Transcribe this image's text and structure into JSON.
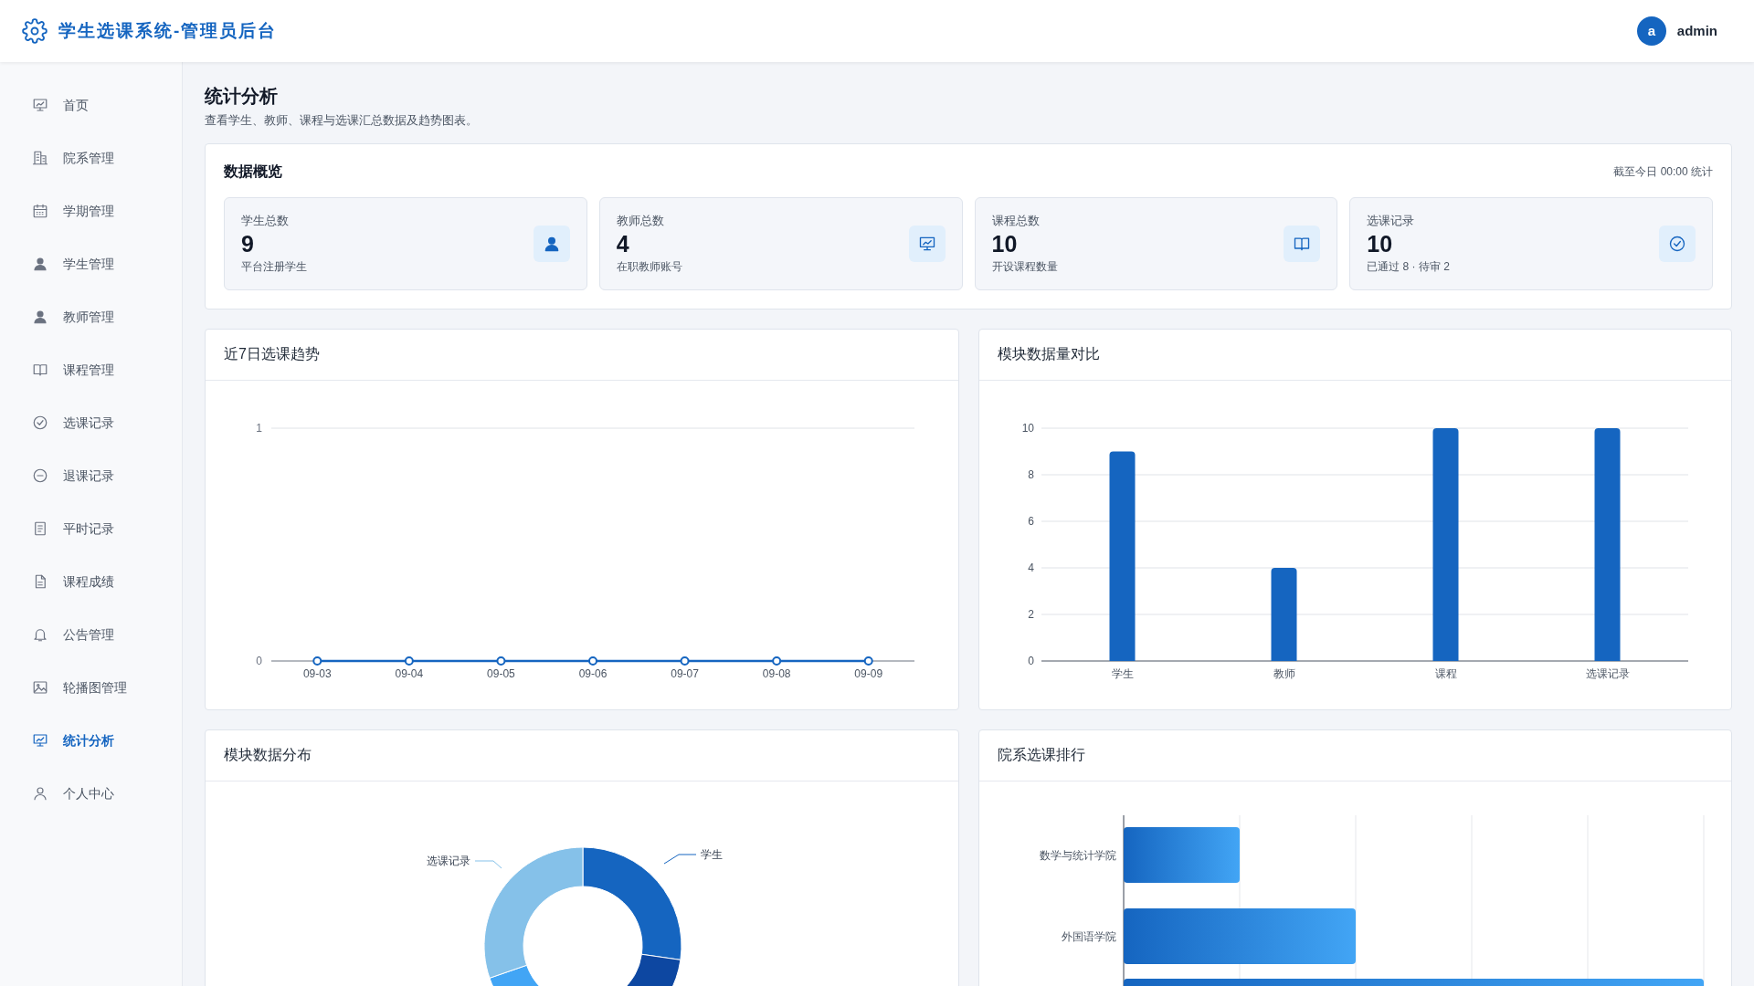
{
  "header": {
    "title": "学生选课系统-管理员后台",
    "user": {
      "avatar_letter": "a",
      "name": "admin"
    }
  },
  "sidebar": {
    "items": [
      {
        "label": "首页",
        "selected": false
      },
      {
        "label": "院系管理",
        "selected": false
      },
      {
        "label": "学期管理",
        "selected": false
      },
      {
        "label": "学生管理",
        "selected": false
      },
      {
        "label": "教师管理",
        "selected": false
      },
      {
        "label": "课程管理",
        "selected": false
      },
      {
        "label": "选课记录",
        "selected": false
      },
      {
        "label": "退课记录",
        "selected": false
      },
      {
        "label": "平时记录",
        "selected": false
      },
      {
        "label": "课程成绩",
        "selected": false
      },
      {
        "label": "公告管理",
        "selected": false
      },
      {
        "label": "轮播图管理",
        "selected": false
      },
      {
        "label": "统计分析",
        "selected": true
      },
      {
        "label": "个人中心",
        "selected": false
      }
    ]
  },
  "page": {
    "title": "统计分析",
    "subtitle": "查看学生、教师、课程与选课汇总数据及趋势图表。"
  },
  "overview": {
    "title": "数据概览",
    "note": "截至今日 00:00 统计",
    "stats": [
      {
        "label": "学生总数",
        "value": "9",
        "caption": "平台注册学生"
      },
      {
        "label": "教师总数",
        "value": "4",
        "caption": "在职教师账号"
      },
      {
        "label": "课程总数",
        "value": "10",
        "caption": "开设课程数量"
      },
      {
        "label": "选课记录",
        "value": "10",
        "caption": "已通过 8 · 待审 2"
      }
    ]
  },
  "trend": {
    "title": "近7日选课趋势",
    "chart_data": {
      "type": "line",
      "categories": [
        "09-03",
        "09-04",
        "09-05",
        "09-06",
        "09-07",
        "09-08",
        "09-09"
      ],
      "series": [
        {
          "color": "#1565c0",
          "marker": "circle",
          "values": [
            0,
            0,
            0,
            0,
            0,
            0,
            0
          ]
        }
      ],
      "grid": true,
      "ylim": [
        0,
        1
      ],
      "yticks": [
        0,
        1
      ]
    }
  },
  "compare": {
    "title": "模块数据量对比",
    "chart_data": {
      "type": "bar",
      "categories": [
        "学生",
        "教师",
        "课程",
        "选课记录"
      ],
      "series": [
        {
          "color": "#1565c0",
          "values": [
            9,
            4,
            10,
            10
          ]
        }
      ],
      "grid": true,
      "ylim": [
        0,
        10
      ],
      "yticks": [
        0,
        2,
        4,
        6,
        8,
        10
      ]
    }
  },
  "distribution": {
    "title": "模块数据分布",
    "labels": [
      "学生",
      "选课记录"
    ]
  },
  "ranking": {
    "title": "院系选课排行",
    "labels": [
      "数学与统计学院",
      "外国语学院"
    ]
  }
}
